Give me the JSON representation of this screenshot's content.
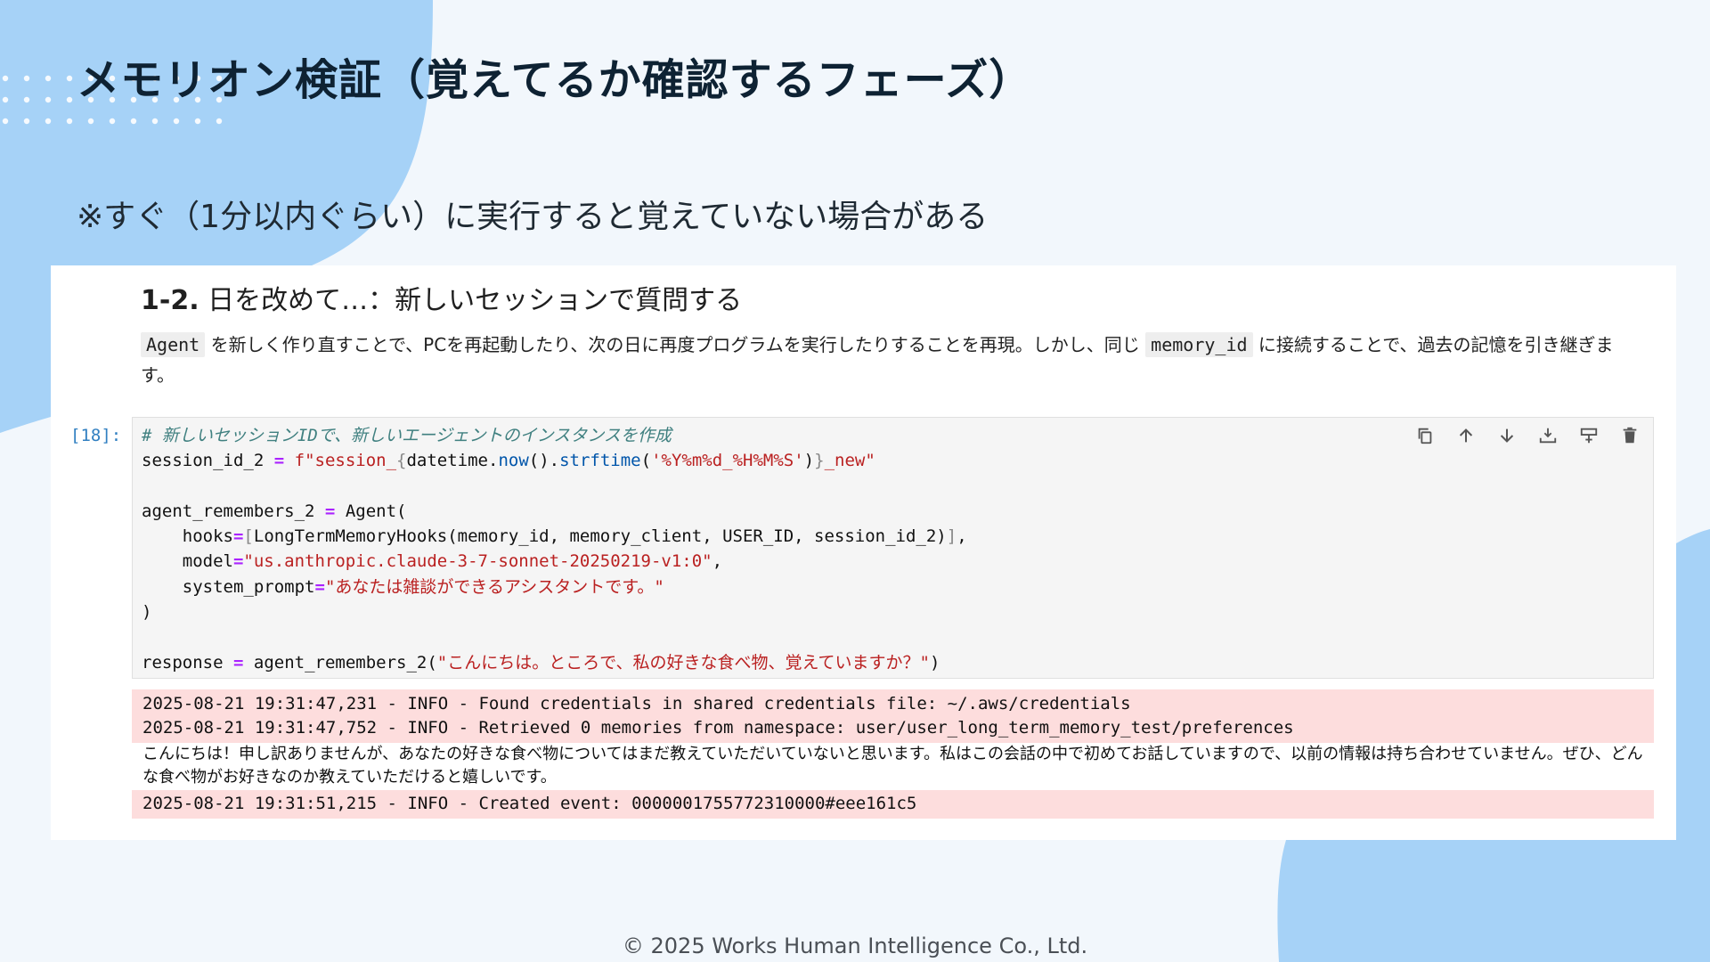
{
  "slide": {
    "title": "メモリオン検証（覚えてるか確認するフェーズ）",
    "note": "※すぐ（1分以内ぐらい）に実行すると覚えていない場合がある",
    "footer": "© 2025 Works Human Intelligence Co., Ltd."
  },
  "notebook": {
    "heading_num": "1-2.",
    "heading_text": " 日を改めて…：新しいセッションで質問する",
    "desc": {
      "code1": "Agent",
      "part1": " を新しく作り直すことで、PCを再起動したり、次の日に再度プログラムを実行したりすることを再現。しかし、同じ ",
      "code2": "memory_id",
      "part2": " に接続することで、過去の記憶を引き継ぎます。"
    },
    "prompt": "[18]:",
    "code": {
      "comment": "# 新しいセッションIDで、新しいエージェントのインスタンスを作成",
      "session_var": "session_id_2",
      "fprefix": "f\"session_",
      "datetime": "datetime",
      "now": "now",
      "strftime": "strftime",
      "fmt": "'%Y%m%d_%H%M%S'",
      "fsuffix": "_new\"",
      "agent_var": "agent_remembers_2",
      "agent_cls": "Agent(",
      "hooks_kw": "hooks",
      "hooks_val": "LongTermMemoryHooks(memory_id, memory_client, USER_ID, session_id_2)",
      "model_kw": "model",
      "model_val": "\"us.anthropic.claude-3-7-sonnet-20250219-v1:0\"",
      "prompt_kw": "system_prompt",
      "prompt_val": "\"あなたは雑談ができるアシスタントです。\"",
      "close": ")",
      "resp_var": "response",
      "resp_call": "agent_remembers_2(",
      "resp_str": "\"こんにちは。ところで、私の好きな食べ物、覚えていますか？\"",
      "resp_close": ")"
    },
    "toolbar": [
      "copy-icon",
      "arrow-up-icon",
      "arrow-down-icon",
      "insert-above-icon",
      "insert-below-icon",
      "trash-icon"
    ],
    "output": {
      "log1": "2025-08-21 19:31:47,231 - INFO - Found credentials in shared credentials file: ~/.aws/credentials",
      "log2": "2025-08-21 19:31:47,752 - INFO - Retrieved 0 memories from namespace: user/user_long_term_memory_test/preferences",
      "reply": "こんにちは！申し訳ありませんが、あなたの好きな食べ物についてはまだ教えていただいていないと思います。私はこの会話の中で初めてお話していますので、以前の情報は持ち合わせていません。ぜひ、どんな食べ物がお好きなのか教えていただけると嬉しいです。",
      "log3": "2025-08-21 19:31:51,215 - INFO - Created event: 0000001755772310000#eee161c5"
    }
  },
  "colors": {
    "blob": "#a6d2f7",
    "background": "#f2f7fc",
    "stderr": "#fddddd"
  }
}
